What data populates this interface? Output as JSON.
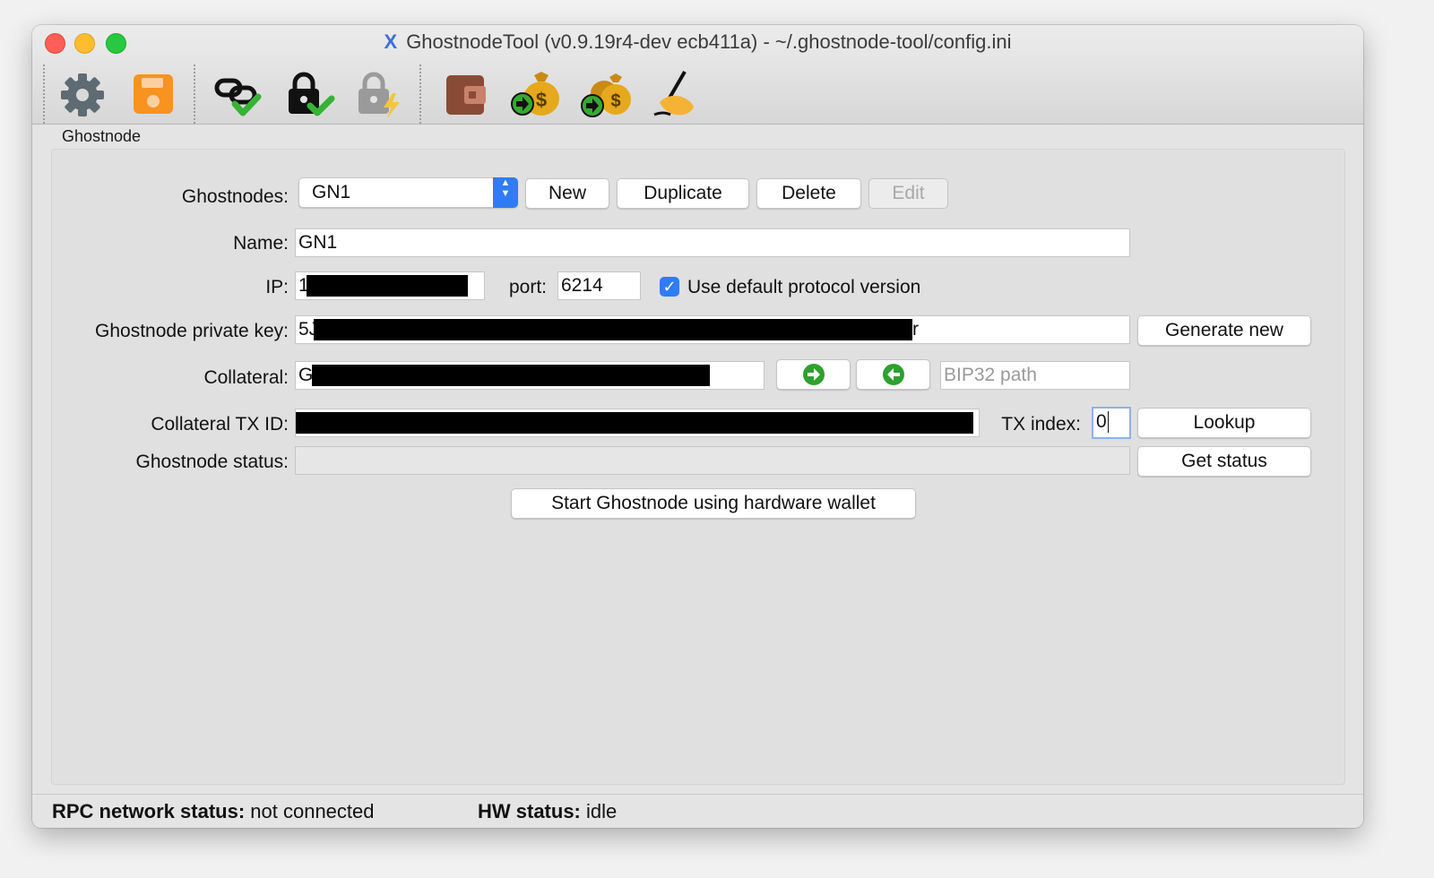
{
  "window": {
    "title": "GhostnodeTool (v0.9.19r4-dev ecb411a) - ~/.ghostnode-tool/config.ini"
  },
  "toolbar": {
    "buttons": [
      {
        "name": "settings",
        "icon": "gear-icon"
      },
      {
        "name": "save",
        "icon": "save-icon"
      },
      {
        "name": "connect",
        "icon": "link-check-icon"
      },
      {
        "name": "hw-connect",
        "icon": "lock-check-icon"
      },
      {
        "name": "hw-disconnect",
        "icon": "lock-lightning-icon"
      },
      {
        "name": "wallet",
        "icon": "wallet-icon"
      },
      {
        "name": "send",
        "icon": "money-bag-send-icon"
      },
      {
        "name": "send-multi",
        "icon": "money-bags-send-icon"
      },
      {
        "name": "sign",
        "icon": "signing-hand-icon"
      }
    ]
  },
  "tab": {
    "label": "Ghostnode"
  },
  "form": {
    "ghostnodes_label": "Ghostnodes:",
    "ghostnodes_selected": "GN1",
    "new_label": "New",
    "duplicate_label": "Duplicate",
    "delete_label": "Delete",
    "edit_label": "Edit",
    "name_label": "Name:",
    "name_value": "GN1",
    "ip_label": "IP:",
    "ip_value": "1",
    "port_label": "port:",
    "port_value": "6214",
    "default_protocol_label": "Use default protocol version",
    "default_protocol_checked": true,
    "private_key_label": "Ghostnode private key:",
    "private_key_prefix": "5J",
    "private_key_suffix": "r",
    "generate_new_label": "Generate new",
    "collateral_label": "Collateral:",
    "collateral_prefix": "G",
    "bip32_placeholder": "BIP32 path",
    "collateral_tx_label": "Collateral TX ID:",
    "tx_index_label": "TX index:",
    "tx_index_value": "0",
    "lookup_label": "Lookup",
    "status_label": "Ghostnode status:",
    "status_value": "",
    "get_status_label": "Get status",
    "start_label": "Start Ghostnode using hardware wallet"
  },
  "statusbar": {
    "rpc_label": "RPC network status:",
    "rpc_value": "not connected",
    "hw_label": "HW status:",
    "hw_value": "idle"
  },
  "colors": {
    "accent": "#2f7cf6",
    "green_arrow": "#2ea12e",
    "save_orange": "#f7931e",
    "wallet_brown": "#8a4b36"
  }
}
